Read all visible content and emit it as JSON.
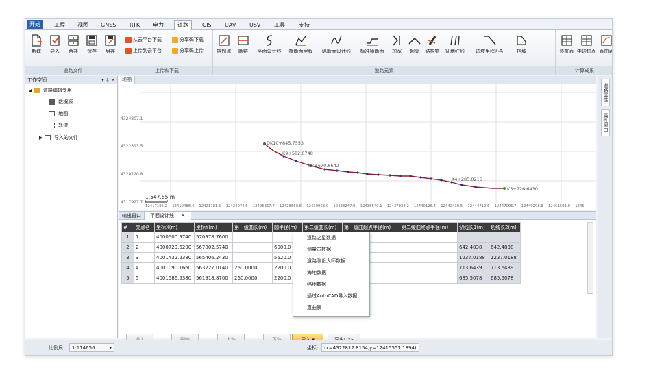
{
  "menu": [
    "开始",
    "工程",
    "视图",
    "GNSS",
    "RTK",
    "电力",
    "道路",
    "GIS",
    "UAV",
    "USV",
    "工具",
    "支持"
  ],
  "ribbon": {
    "file_group": {
      "label": "道路文件",
      "buttons": [
        "新建",
        "导入",
        "合并",
        "保存",
        "另存"
      ]
    },
    "transfer_group": {
      "label": "上传和下载",
      "buttons": [
        "从云平台下载",
        "分享码下载",
        "上传到云平台",
        "分享码上传"
      ]
    },
    "elements_group": {
      "label": "道路元素",
      "buttons": [
        "控制点",
        "断链",
        "平面设计线",
        "横断面里程",
        "纵断面设计线",
        "标准横断面",
        "加宽",
        "超高",
        "结构物",
        "征地红线",
        "边坡里程匹配",
        "挡坡"
      ]
    },
    "results_group": {
      "label": "计算成果",
      "buttons": [
        "逐桩表",
        "中边桩表",
        "直曲表",
        "线"
      ]
    }
  },
  "workspace": {
    "title": "工作空间",
    "controls": "▾ ⇩ ✕",
    "root": "道路编辑专用",
    "children": [
      "数据源",
      "地图",
      "轨迹",
      "导入的文件"
    ]
  },
  "view": {
    "tab": "视图",
    "y_ticks": [
      "4324807.1",
      "4322513.5",
      "4320220.8",
      "4317927.7"
    ],
    "x_ticks": [
      "12417195.2",
      "12419488.4",
      "12421781.5",
      "12424074.6",
      "12426367.7",
      "12428660.8",
      "12430953.9",
      "12433247.0",
      "12435540.1",
      "12437833.2",
      "12440126.4",
      "12442419.5",
      "12444712.6",
      "12447005.7",
      "12449298.8",
      "12451591.9",
      "1245"
    ],
    "scale": "1,547.85 m",
    "labels": [
      "DK10+845.7553",
      "K9+582.0748",
      "K7+670.6642",
      "K4+285.0216",
      "K5+726.6430"
    ],
    "color_line": "#8a1f2b",
    "color_point": "#2b2f9e",
    "color_end": "#3a9a3a"
  },
  "right_tabs": [
    "道路属性",
    "属性窗口"
  ],
  "bottom_tabs": [
    "输出窗口",
    "平面设计线"
  ],
  "table": {
    "headers": [
      "#",
      "交点名",
      "坐标X(m)",
      "坐标Y(m)",
      "第一缓曲长(m)",
      "圆半径(m)",
      "第二缓曲长(m)",
      "第一缓曲起点半径(m)",
      "第二缓曲终点半径(m)",
      "切线长1(m)",
      "切线长2(m)"
    ],
    "rows": [
      [
        "1",
        "1",
        "4000500.9740",
        "570978.7600",
        "",
        "",
        "",
        "",
        "",
        "",
        ""
      ],
      [
        "2",
        "2",
        "4000729.6200",
        "567802.5740",
        "",
        "6000.0",
        "",
        "",
        "",
        "642.4838",
        "642.4838"
      ],
      [
        "3",
        "3",
        "4001432.2380",
        "565406.2430",
        "",
        "5520.0",
        "",
        "",
        "",
        "1237.0188",
        "1237.0188"
      ],
      [
        "4",
        "4",
        "4001090.1660",
        "563227.0140",
        "260.0000",
        "2200.0",
        "",
        "",
        "",
        "713.6439",
        "713.6439"
      ],
      [
        "5",
        "5",
        "4001586.5380",
        "561918.8700",
        "260.0000",
        "2200.0",
        "",
        "",
        "",
        "685.5078",
        "685.5078"
      ]
    ]
  },
  "actions": {
    "insert": "插入",
    "delete": "删除",
    "up": "上移",
    "down": "下移",
    "import": "导入",
    "export": "导出DXF"
  },
  "dropdown": [
    "道路之星数据",
    "测量员数据",
    "道路测设大师数据",
    "海地数据",
    "纬地数据",
    "通过AutoCAD导入数据",
    "直曲表"
  ],
  "status": {
    "scale_label": "比例尺:",
    "scale_value": "1:114656",
    "coord_label": "坐标:",
    "coord_value": "(x=4322812.8154,y=12415551.1894)"
  }
}
